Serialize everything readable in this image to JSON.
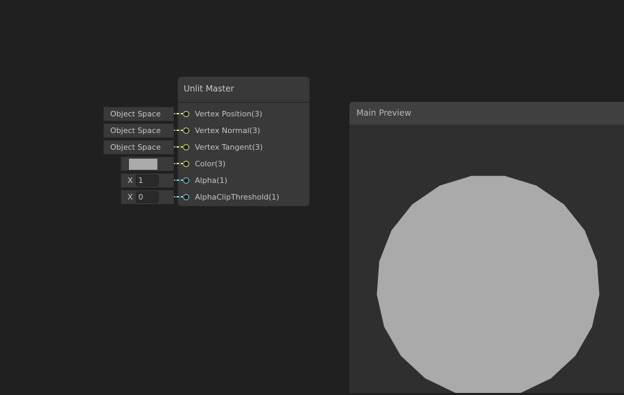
{
  "node": {
    "title": "Unlit Master",
    "slots": [
      {
        "label": "Vertex Position(3)",
        "type": "vector3"
      },
      {
        "label": "Vertex Normal(3)",
        "type": "vector3"
      },
      {
        "label": "Vertex Tangent(3)",
        "type": "vector3"
      },
      {
        "label": "Color(3)",
        "type": "vector3"
      },
      {
        "label": "Alpha(1)",
        "type": "float"
      },
      {
        "label": "AlphaClipThreshold(1)",
        "type": "float"
      }
    ]
  },
  "inputs": {
    "space1": "Object Space",
    "space2": "Object Space",
    "space3": "Object Space",
    "color": "#aaaaaa",
    "alpha_axis": "X",
    "alpha": "1",
    "clip_axis": "X",
    "clip": "0"
  },
  "colors": {
    "vector3": "#e8e680",
    "float": "#7fd8e6"
  },
  "preview": {
    "title": "Main Preview"
  }
}
